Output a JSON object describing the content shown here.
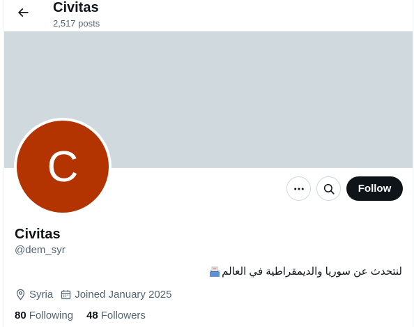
{
  "header": {
    "title": "Civitas",
    "post_count": "2,517 posts",
    "back_icon": "arrow-left-icon"
  },
  "profile": {
    "avatar_letter": "C",
    "avatar_color": "#b33400",
    "banner_color": "#cfd9de",
    "display_name": "Civitas",
    "handle": "@dem_syr",
    "bio": "لنتحدث عن سوريا والديمقراطية في العالم",
    "bio_emoji": "ballot-box-icon",
    "location": "Syria",
    "joined": "Joined January 2025"
  },
  "actions": {
    "more_icon": "more-icon",
    "search_icon": "search-icon",
    "follow_label": "Follow"
  },
  "stats": {
    "following_count": "80",
    "following_label": "Following",
    "followers_count": "48",
    "followers_label": "Followers"
  },
  "colors": {
    "text_primary": "#0f1419",
    "text_secondary": "#536471",
    "border": "#cfd9de"
  }
}
